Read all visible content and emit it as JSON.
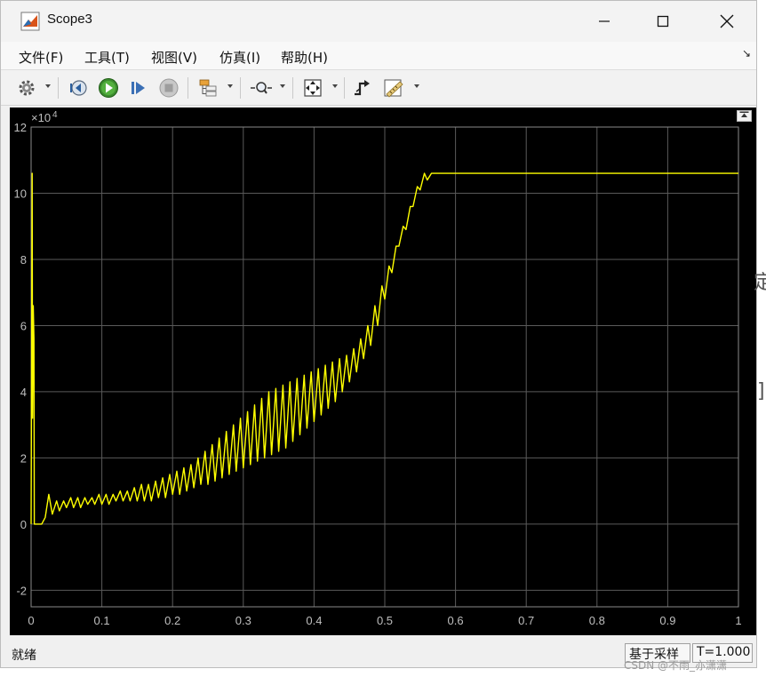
{
  "window": {
    "title": "Scope3"
  },
  "menu": {
    "items": [
      {
        "label": "文件(F)"
      },
      {
        "label": "工具(T)"
      },
      {
        "label": "视图(V)"
      },
      {
        "label": "仿真(I)"
      },
      {
        "label": "帮助(H)"
      }
    ]
  },
  "toolbar": {
    "icons": [
      "gear-icon",
      "step-back-icon",
      "run-icon",
      "step-forward-icon",
      "stop-icon",
      "signal-tree-icon",
      "zoom-icon",
      "fit-axes-icon",
      "trigger-icon",
      "measure-icon"
    ]
  },
  "status": {
    "text": "就绪",
    "mode": "基于采样",
    "time": "T=1.000"
  },
  "side": {
    "glyph1": "定",
    "glyph2": "]"
  },
  "watermark": "CSDN @不雨_亦潇潇",
  "colors": {
    "trace": "#ffff00",
    "background": "#000000",
    "grid": "#5a5a5a",
    "axis_text": "#bfbfbf"
  },
  "chart_data": {
    "type": "line",
    "exponent_label": "×10",
    "exponent_sup": "4",
    "xlim": [
      0,
      1
    ],
    "ylim": [
      -2.5,
      12
    ],
    "xticks": [
      0,
      0.1,
      0.2,
      0.3,
      0.4,
      0.5,
      0.6,
      0.7,
      0.8,
      0.9,
      1
    ],
    "xtick_labels": [
      "0",
      "0.1",
      "0.2",
      "0.3",
      "0.4",
      "0.5",
      "0.6",
      "0.7",
      "0.8",
      "0.9",
      "1"
    ],
    "yticks": [
      -2,
      0,
      2,
      4,
      6,
      8,
      10,
      12
    ],
    "ytick_labels": [
      "-2",
      "0",
      "2",
      "4",
      "6",
      "8",
      "10",
      "12"
    ],
    "grid": true,
    "series": [
      {
        "color": "#ffff00",
        "x": [
          0,
          0.0015,
          0.002,
          0.003,
          0.004,
          0.0045,
          0.005,
          0.006,
          0.01,
          0.015,
          0.02,
          0.025,
          0.03,
          0.036,
          0.04,
          0.046,
          0.05,
          0.056,
          0.06,
          0.066,
          0.07,
          0.076,
          0.08,
          0.086,
          0.09,
          0.096,
          0.1,
          0.106,
          0.11,
          0.116,
          0.12,
          0.126,
          0.13,
          0.136,
          0.14,
          0.146,
          0.15,
          0.156,
          0.16,
          0.166,
          0.17,
          0.176,
          0.18,
          0.186,
          0.19,
          0.196,
          0.2,
          0.206,
          0.21,
          0.216,
          0.22,
          0.226,
          0.23,
          0.236,
          0.24,
          0.246,
          0.25,
          0.256,
          0.26,
          0.266,
          0.27,
          0.276,
          0.28,
          0.286,
          0.29,
          0.296,
          0.3,
          0.306,
          0.31,
          0.316,
          0.32,
          0.326,
          0.33,
          0.336,
          0.34,
          0.346,
          0.35,
          0.356,
          0.36,
          0.366,
          0.37,
          0.376,
          0.38,
          0.386,
          0.39,
          0.396,
          0.4,
          0.406,
          0.41,
          0.416,
          0.42,
          0.426,
          0.43,
          0.436,
          0.44,
          0.446,
          0.45,
          0.456,
          0.46,
          0.466,
          0.47,
          0.476,
          0.48,
          0.486,
          0.49,
          0.496,
          0.5,
          0.506,
          0.51,
          0.516,
          0.52,
          0.526,
          0.53,
          0.536,
          0.54,
          0.546,
          0.55,
          0.556,
          0.56,
          0.566,
          0.57,
          0.575,
          0.6,
          0.65,
          0.7,
          0.75,
          0.8,
          0.85,
          0.9,
          0.95,
          1.0
        ],
        "y": [
          0,
          10.6,
          3.2,
          6.6,
          5.6,
          0,
          0,
          0,
          0,
          0,
          0.2,
          0.9,
          0.3,
          0.7,
          0.4,
          0.7,
          0.5,
          0.8,
          0.5,
          0.8,
          0.5,
          0.8,
          0.6,
          0.8,
          0.6,
          0.9,
          0.6,
          0.9,
          0.6,
          0.9,
          0.7,
          1.0,
          0.7,
          1.0,
          0.7,
          1.1,
          0.7,
          1.2,
          0.7,
          1.2,
          0.7,
          1.3,
          0.8,
          1.4,
          0.8,
          1.5,
          0.9,
          1.6,
          0.9,
          1.7,
          1.0,
          1.8,
          1.1,
          2.0,
          1.2,
          2.2,
          1.2,
          2.4,
          1.3,
          2.6,
          1.4,
          2.8,
          1.5,
          3.0,
          1.6,
          3.2,
          1.7,
          3.4,
          1.8,
          3.6,
          1.9,
          3.8,
          2.0,
          4.0,
          2.1,
          4.1,
          2.2,
          4.2,
          2.3,
          4.3,
          2.5,
          4.4,
          2.7,
          4.5,
          2.9,
          4.6,
          3.1,
          4.7,
          3.3,
          4.8,
          3.5,
          4.9,
          3.7,
          5.0,
          4.0,
          5.1,
          4.3,
          5.3,
          4.6,
          5.6,
          5.0,
          6.0,
          5.4,
          6.6,
          6.0,
          7.2,
          6.8,
          7.8,
          7.6,
          8.4,
          8.4,
          9.0,
          8.9,
          9.6,
          9.6,
          10.2,
          10.1,
          10.6,
          10.4,
          10.6,
          10.6,
          10.6,
          10.6,
          10.6,
          10.6,
          10.6,
          10.6,
          10.6,
          10.6,
          10.6,
          10.6
        ]
      }
    ]
  }
}
